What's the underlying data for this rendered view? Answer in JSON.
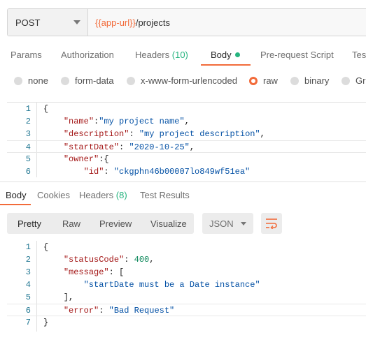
{
  "request": {
    "method": "POST",
    "url_var": "{{app-url}}",
    "url_path": "/projects"
  },
  "request_tabs": [
    {
      "label": "Params"
    },
    {
      "label": "Authorization"
    },
    {
      "label": "Headers",
      "count": "(10)"
    },
    {
      "label": "Body",
      "active": true
    },
    {
      "label": "Pre-request Script"
    },
    {
      "label": "Tes"
    }
  ],
  "body_types": [
    {
      "label": "none"
    },
    {
      "label": "form-data"
    },
    {
      "label": "x-www-form-urlencoded"
    },
    {
      "label": "raw",
      "checked": true
    },
    {
      "label": "binary"
    },
    {
      "label": "Gra"
    }
  ],
  "request_body": {
    "line_numbers": [
      "1",
      "2",
      "3",
      "4",
      "5",
      "6"
    ],
    "lines": [
      "{",
      "    \"name\":\"my project name\",",
      "    \"description\": \"my project description\",",
      "    \"startDate\": \"2020-10-25\",",
      "    \"owner\":{",
      "        \"id\": \"ckgphn46b00007lo849wf51ea\""
    ]
  },
  "response_tabs": [
    {
      "label": "Body",
      "active": true
    },
    {
      "label": "Cookies"
    },
    {
      "label": "Headers",
      "count": "(8)"
    },
    {
      "label": "Test Results"
    }
  ],
  "view_modes": [
    "Pretty",
    "Raw",
    "Preview",
    "Visualize"
  ],
  "format": "JSON",
  "response_body": {
    "line_numbers": [
      "1",
      "2",
      "3",
      "4",
      "5",
      "6",
      "7"
    ],
    "lines": [
      "{",
      "    \"statusCode\": 400,",
      "    \"message\": [",
      "        \"startDate must be a Date instance\"",
      "    ],",
      "    \"error\": \"Bad Request\"",
      "}"
    ]
  },
  "colors": {
    "accent": "#f26b3a",
    "count_green": "#26b47f",
    "json_key": "#a31515",
    "json_string": "#0451a5",
    "json_number": "#098658"
  }
}
